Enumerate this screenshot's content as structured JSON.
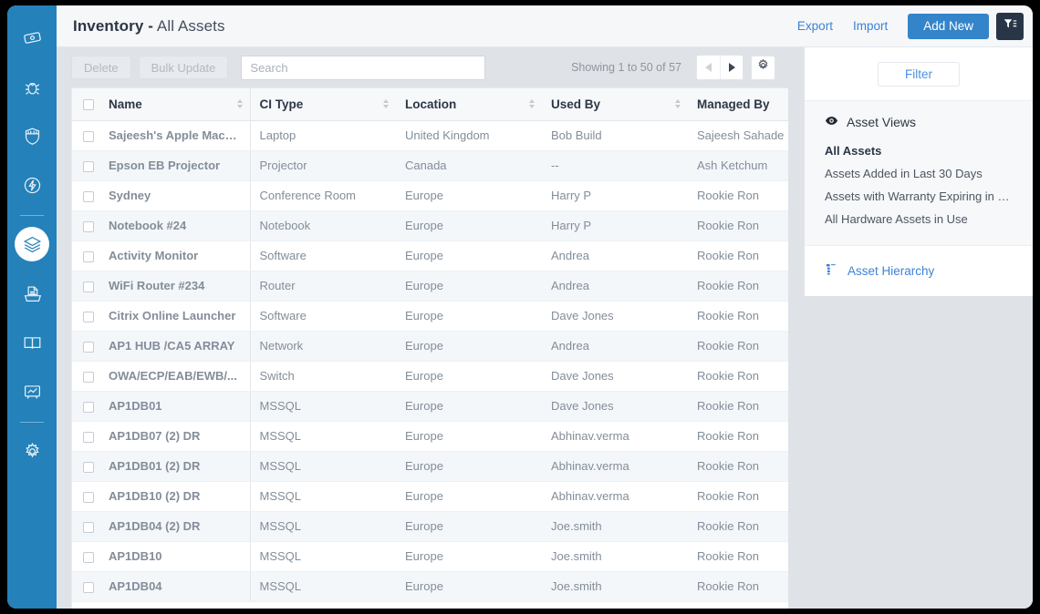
{
  "sidebar": {
    "items": [
      {
        "name": "tickets",
        "icon": "ticket-icon",
        "active": false
      },
      {
        "name": "problems",
        "icon": "bug-icon",
        "active": false
      },
      {
        "name": "changes",
        "icon": "shield-icon",
        "active": false
      },
      {
        "name": "releases",
        "icon": "bolt-icon",
        "active": false
      },
      {
        "name": "assets",
        "icon": "layers-icon",
        "active": true
      },
      {
        "name": "purchase",
        "icon": "printer-icon",
        "active": false
      },
      {
        "name": "knowledge",
        "icon": "book-icon",
        "active": false
      },
      {
        "name": "reports",
        "icon": "chart-board-icon",
        "active": false
      },
      {
        "name": "admin",
        "icon": "gear-icon",
        "active": false
      }
    ]
  },
  "header": {
    "title_strong": "Inventory -",
    "title_light": "All Assets",
    "export_label": "Export",
    "import_label": "Import",
    "add_new_label": "Add New",
    "filter_icon": "funnel-icon"
  },
  "toolbar": {
    "delete_label": "Delete",
    "bulk_update_label": "Bulk Update",
    "search_placeholder": "Search",
    "search_value": "",
    "showing_text": "Showing 1 to 50 of 57",
    "prev_icon": "triangle-left-icon",
    "next_icon": "triangle-right-icon",
    "settings_icon": "gear-icon"
  },
  "table": {
    "columns": [
      {
        "key": "name",
        "label": "Name",
        "sortable": true
      },
      {
        "key": "ci_type",
        "label": "CI Type",
        "sortable": true
      },
      {
        "key": "location",
        "label": "Location",
        "sortable": true
      },
      {
        "key": "used_by",
        "label": "Used By",
        "sortable": true
      },
      {
        "key": "managed_by",
        "label": "Managed By",
        "sortable": false
      }
    ],
    "rows": [
      {
        "name": "Sajeesh's Apple MacB...",
        "ci_type": "Laptop",
        "location": "United Kingdom",
        "used_by": "Bob Build",
        "managed_by": "Sajeesh Sahade"
      },
      {
        "name": "Epson EB Projector",
        "ci_type": "Projector",
        "location": "Canada",
        "used_by": "--",
        "managed_by": "Ash Ketchum"
      },
      {
        "name": "Sydney",
        "ci_type": "Conference Room",
        "location": "Europe",
        "used_by": "Harry P",
        "managed_by": "Rookie Ron"
      },
      {
        "name": "Notebook #24",
        "ci_type": "Notebook",
        "location": "Europe",
        "used_by": "Harry P",
        "managed_by": "Rookie Ron"
      },
      {
        "name": "Activity Monitor",
        "ci_type": "Software",
        "location": "Europe",
        "used_by": "Andrea",
        "managed_by": "Rookie Ron"
      },
      {
        "name": "WiFi Router #234",
        "ci_type": "Router",
        "location": "Europe",
        "used_by": "Andrea",
        "managed_by": "Rookie Ron"
      },
      {
        "name": "Citrix Online Launcher",
        "ci_type": "Software",
        "location": "Europe",
        "used_by": "Dave Jones",
        "managed_by": "Rookie Ron"
      },
      {
        "name": "AP1 HUB /CA5 ARRAY",
        "ci_type": "Network",
        "location": "Europe",
        "used_by": "Andrea",
        "managed_by": "Rookie Ron"
      },
      {
        "name": "OWA/ECP/EAB/EWB/...",
        "ci_type": "Switch",
        "location": "Europe",
        "used_by": "Dave Jones",
        "managed_by": "Rookie Ron"
      },
      {
        "name": "AP1DB01",
        "ci_type": "MSSQL",
        "location": "Europe",
        "used_by": "Dave Jones",
        "managed_by": "Rookie Ron"
      },
      {
        "name": "AP1DB07 (2) DR",
        "ci_type": "MSSQL",
        "location": "Europe",
        "used_by": "Abhinav.verma",
        "managed_by": "Rookie Ron"
      },
      {
        "name": "AP1DB01 (2) DR",
        "ci_type": "MSSQL",
        "location": "Europe",
        "used_by": "Abhinav.verma",
        "managed_by": "Rookie Ron"
      },
      {
        "name": "AP1DB10 (2) DR",
        "ci_type": "MSSQL",
        "location": "Europe",
        "used_by": "Abhinav.verma",
        "managed_by": "Rookie Ron"
      },
      {
        "name": "AP1DB04 (2) DR",
        "ci_type": "MSSQL",
        "location": "Europe",
        "used_by": "Joe.smith",
        "managed_by": "Rookie Ron"
      },
      {
        "name": "AP1DB10",
        "ci_type": "MSSQL",
        "location": "Europe",
        "used_by": "Joe.smith",
        "managed_by": "Rookie Ron"
      },
      {
        "name": "AP1DB04",
        "ci_type": "MSSQL",
        "location": "Europe",
        "used_by": "Joe.smith",
        "managed_by": "Rookie Ron"
      }
    ]
  },
  "right_panel": {
    "filter_label": "Filter",
    "views_icon": "eye-icon",
    "views_title": "Asset Views",
    "views": [
      {
        "label": "All Assets",
        "selected": true
      },
      {
        "label": "Assets Added in Last 30 Days",
        "selected": false
      },
      {
        "label": "Assets with Warranty Expiring in next ...",
        "selected": false
      },
      {
        "label": "All Hardware Assets in Use",
        "selected": false
      }
    ],
    "hierarchy_icon": "tree-hierarchy-icon",
    "hierarchy_label": "Asset Hierarchy"
  },
  "colors": {
    "sidebar_blue": "#2481ba",
    "accent_blue": "#3d82d6",
    "primary_button": "#3484c9",
    "dark_button": "#273547",
    "page_bg": "#dfe3e8",
    "row_alt": "#f4f7fa"
  }
}
